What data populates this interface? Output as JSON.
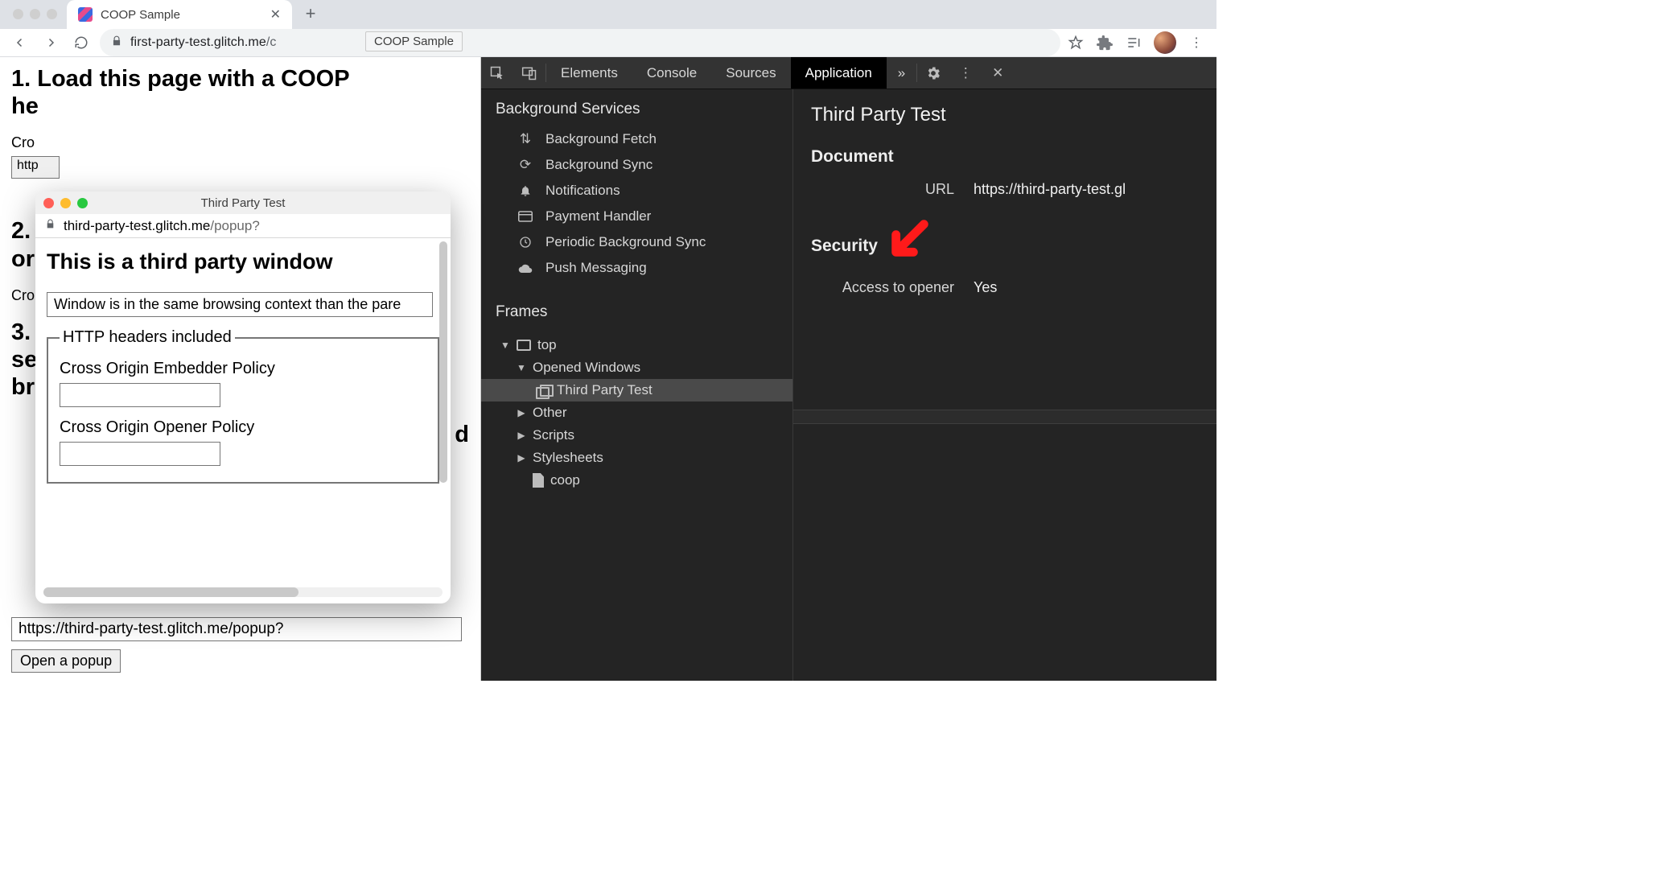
{
  "browser": {
    "tab_title": "COOP Sample",
    "url_host": "first-party-test.glitch.me",
    "url_path": "/c",
    "tooltip": "COOP Sample"
  },
  "page": {
    "h1a": "1. Load this page with a COOP",
    "h1b": "he",
    "cro_line": "Cro",
    "http_fragment": "http",
    "h2a": "2.",
    "h2b": "or",
    "cro_line2": "Cro",
    "h3a": "3.",
    "h3b": "se",
    "h3c": "br",
    "behind_d": "d",
    "popup_url_value": "https://third-party-test.glitch.me/popup?",
    "open_btn": "Open a popup"
  },
  "popup": {
    "title": "Third Party Test",
    "url_host": "third-party-test.glitch.me",
    "url_path": "/popup?",
    "heading": "This is a third party window",
    "message": "Window is in the same browsing context than the pare",
    "legend": "HTTP headers included",
    "coep_label": "Cross Origin Embedder Policy",
    "coop_label": "Cross Origin Opener Policy"
  },
  "devtools": {
    "tabs": {
      "elements": "Elements",
      "console": "Console",
      "sources": "Sources",
      "application": "Application"
    },
    "side": {
      "bg_title": "Background Services",
      "items": {
        "fetch": "Background Fetch",
        "sync": "Background Sync",
        "notif": "Notifications",
        "payment": "Payment Handler",
        "periodic": "Periodic Background Sync",
        "push": "Push Messaging"
      },
      "frames_title": "Frames",
      "top": "top",
      "opened": "Opened Windows",
      "third_party": "Third Party Test",
      "other": "Other",
      "scripts": "Scripts",
      "stylesheets": "Stylesheets",
      "coop": "coop"
    },
    "main": {
      "title": "Third Party Test",
      "document": "Document",
      "url_label": "URL",
      "url_value": "https://third-party-test.gl",
      "security": "Security",
      "opener_label": "Access to opener",
      "opener_value": "Yes"
    }
  }
}
